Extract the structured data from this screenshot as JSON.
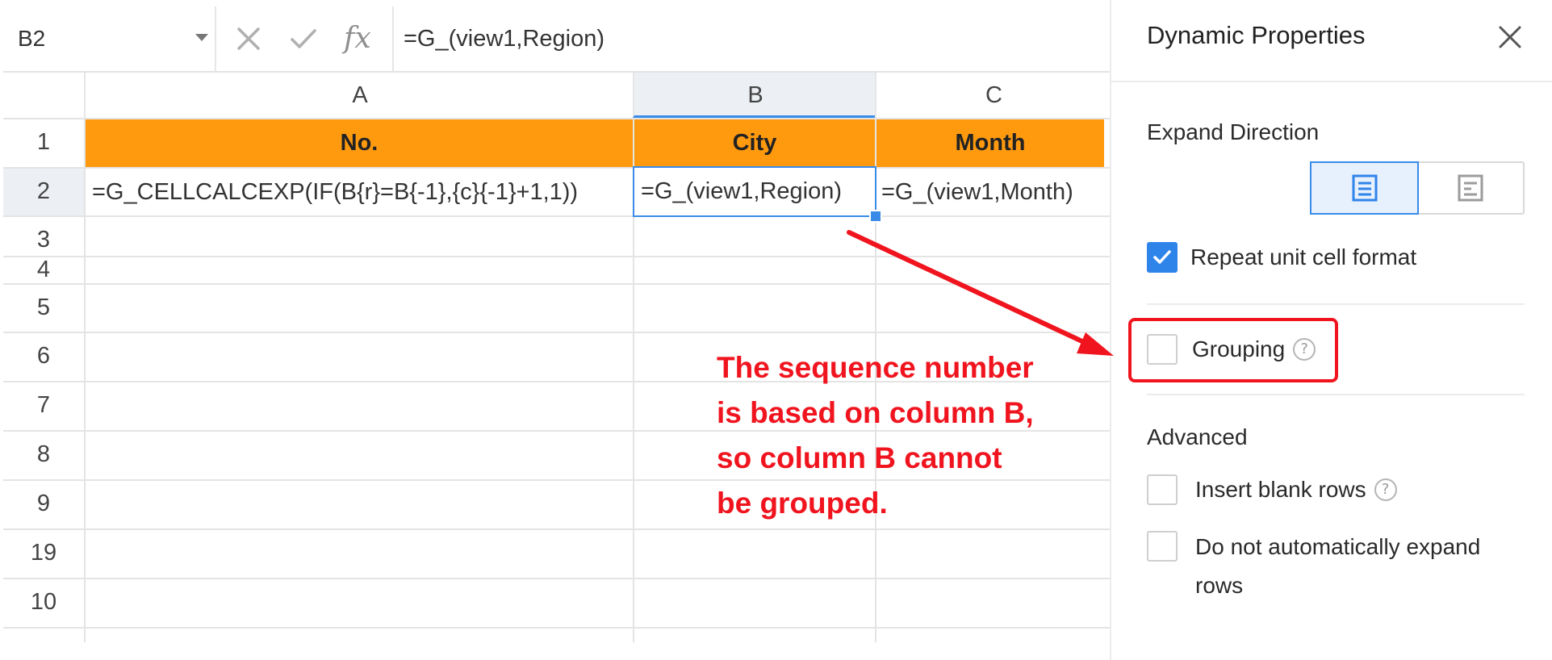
{
  "formula_bar": {
    "cell_ref": "B2",
    "cancel_icon": "close-x-icon",
    "confirm_icon": "check-icon",
    "fx_label": "fx",
    "formula": "=G_(view1,Region)"
  },
  "sheet": {
    "columns": [
      "A",
      "B",
      "C"
    ],
    "selected_column": "B",
    "rows": [
      "1",
      "2",
      "3",
      "4",
      "5",
      "6",
      "7",
      "8",
      "9",
      "19",
      "10"
    ],
    "row1": {
      "a": "No.",
      "b": "City",
      "c": "Month"
    },
    "row2": {
      "a": "=G_CELLCALCEXP(IF(B{r}=B{-1},{c}{-1}+1,1))",
      "b": "=G_(view1,Region)",
      "c": "=G_(view1,Month)"
    },
    "header_fill_color": "#ff9a0f",
    "selection_color": "#3a8be8"
  },
  "annotation": {
    "lines": [
      "The sequence number",
      "is based on column B,",
      "so column B cannot",
      "be grouped."
    ],
    "color": "#f0141e"
  },
  "panel": {
    "title": "Dynamic Properties",
    "close_icon": "close-icon",
    "expand_direction": {
      "label": "Expand Direction",
      "options": [
        "vertical-expand-icon",
        "horizontal-expand-icon"
      ],
      "selected": "vertical-expand-icon"
    },
    "repeat_format": {
      "label": "Repeat unit cell format",
      "checked": true
    },
    "grouping": {
      "label": "Grouping",
      "checked": false,
      "help_icon": "question-icon",
      "help_glyph": "?"
    },
    "advanced": {
      "label": "Advanced",
      "insert_blank_rows": {
        "label": "Insert blank rows",
        "checked": false,
        "help_glyph": "?"
      },
      "no_auto_expand": {
        "label_line1": "Do not automatically expand",
        "label_line2": "rows",
        "checked": false
      }
    },
    "accent_color": "#2f84ea"
  }
}
